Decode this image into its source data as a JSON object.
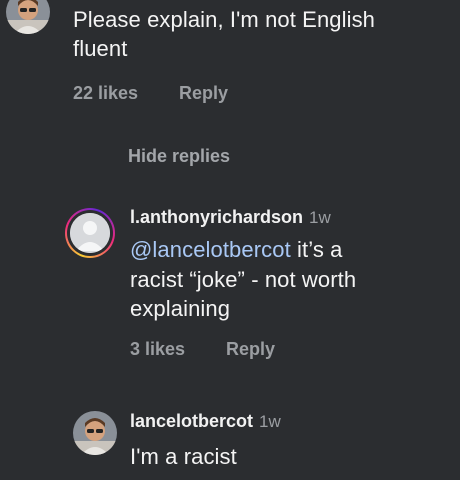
{
  "comments": [
    {
      "text_line1": "Please explain, I'm not English",
      "text_line2": "fluent",
      "likes": "22 likes",
      "reply": "Reply"
    }
  ],
  "hide_replies": "Hide replies",
  "replies": [
    {
      "username": "l.anthonyrichardson",
      "time": "1w",
      "mention": "@lancelotbercot",
      "text_line1_rest": " it’s a",
      "text_line2": "racist “joke” - not worth",
      "text_line3": "explaining",
      "likes": "3 likes",
      "reply": "Reply"
    },
    {
      "username": "lancelotbercot",
      "time": "1w",
      "text_line1": "I'm a racist"
    }
  ],
  "icons": {
    "top_avatar": "user-photo-avatar",
    "story_avatar": "default-user-avatar",
    "bottom_avatar": "user-photo-avatar"
  }
}
